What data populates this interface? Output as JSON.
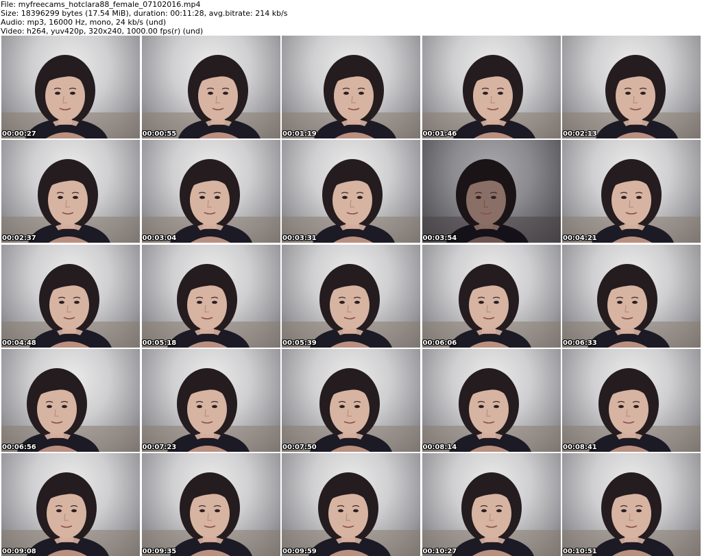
{
  "info": {
    "file": "File: myfreecams_hotclara88_female_07102016.mp4",
    "size": "Size: 18396299 bytes (17.54 MiB), duration: 00:11:28, avg.bitrate: 214 kb/s",
    "audio": "Audio: mp3, 16000 Hz, mono, 24 kb/s (und)",
    "video": "Video: h264, yuv420p, 320x240, 1000.00 fps(r) (und)"
  },
  "thumbnails": [
    {
      "time": "00:00:27"
    },
    {
      "time": "00:00:55"
    },
    {
      "time": "00:01:19"
    },
    {
      "time": "00:01:46"
    },
    {
      "time": "00:02:13"
    },
    {
      "time": "00:02:37"
    },
    {
      "time": "00:03:04"
    },
    {
      "time": "00:03:31"
    },
    {
      "time": "00:03:54",
      "dark": true
    },
    {
      "time": "00:04:21"
    },
    {
      "time": "00:04:48"
    },
    {
      "time": "00:05:18"
    },
    {
      "time": "00:05:39"
    },
    {
      "time": "00:06:06"
    },
    {
      "time": "00:06:33"
    },
    {
      "time": "00:06:56"
    },
    {
      "time": "00:07:23"
    },
    {
      "time": "00:07:50"
    },
    {
      "time": "00:08:14"
    },
    {
      "time": "00:08:41"
    },
    {
      "time": "00:09:08"
    },
    {
      "time": "00:09:35"
    },
    {
      "time": "00:09:59"
    },
    {
      "time": "00:10:27"
    },
    {
      "time": "00:10:51"
    }
  ]
}
